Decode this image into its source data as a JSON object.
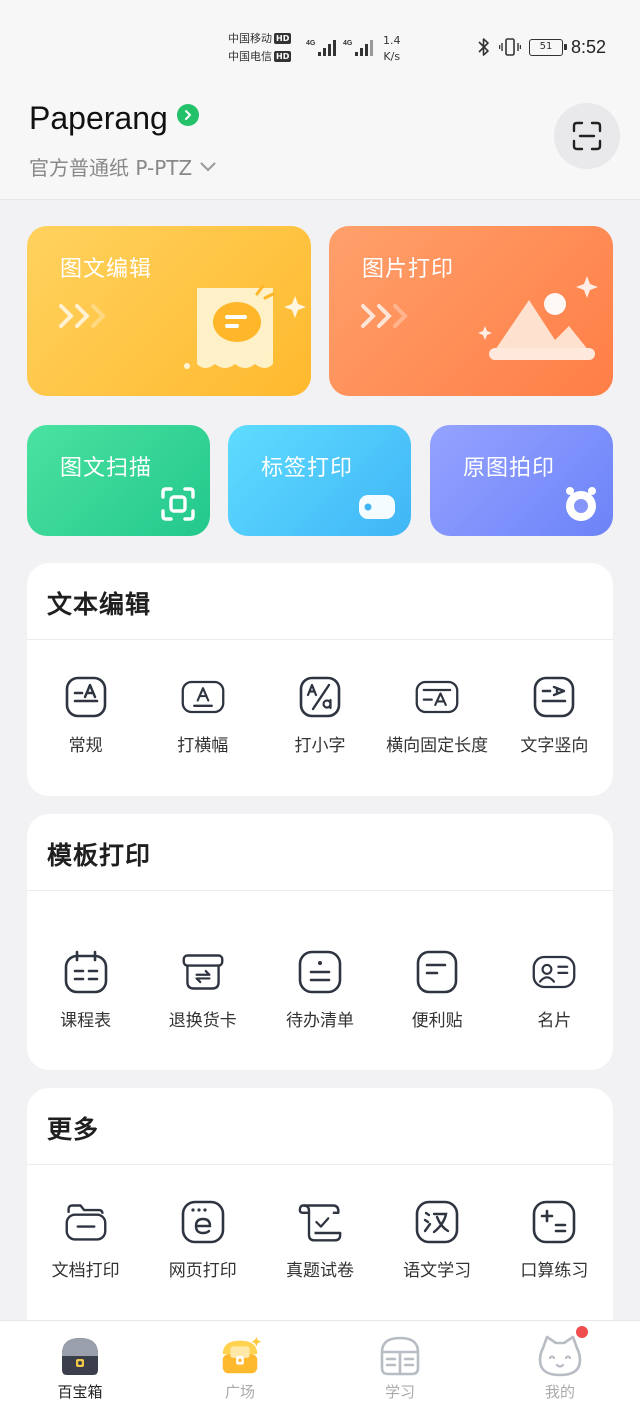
{
  "status_bar": {
    "carrier1": "中国移动",
    "carrier2": "中国电信",
    "hd": "HD",
    "net1": "4G",
    "net2": "4G",
    "speed_value": "1.4",
    "speed_unit": "K/s",
    "battery": "51",
    "time": "8:52"
  },
  "header": {
    "app_name": "Paperang",
    "paper_type": "官方普通纸 P-PTZ"
  },
  "feature_cards": {
    "big": [
      {
        "label": "图文编辑",
        "color": "#ffc542"
      },
      {
        "label": "图片打印",
        "color": "#ff8a55"
      }
    ],
    "mid": [
      {
        "label": "图文扫描",
        "color": "#33d596"
      },
      {
        "label": "标签打印",
        "color": "#4fc8fb"
      },
      {
        "label": "原图拍印",
        "color": "#7f93fb"
      }
    ]
  },
  "sections": {
    "text_edit": {
      "title": "文本编辑",
      "items": [
        {
          "label": "常规",
          "icon": "text-align-icon"
        },
        {
          "label": "打横幅",
          "icon": "banner-icon"
        },
        {
          "label": "打小字",
          "icon": "small-text-icon"
        },
        {
          "label": "横向固定长度",
          "icon": "fixed-length-icon"
        },
        {
          "label": "文字竖向",
          "icon": "vertical-text-icon"
        }
      ]
    },
    "template_print": {
      "title": "模板打印",
      "items": [
        {
          "label": "课程表",
          "icon": "calendar-icon"
        },
        {
          "label": "退换货卡",
          "icon": "return-box-icon"
        },
        {
          "label": "待办清单",
          "icon": "todo-list-icon"
        },
        {
          "label": "便利贴",
          "icon": "sticky-note-icon"
        },
        {
          "label": "名片",
          "icon": "business-card-icon"
        }
      ]
    },
    "more": {
      "title": "更多",
      "items": [
        {
          "label": "文档打印",
          "icon": "folder-icon"
        },
        {
          "label": "网页打印",
          "icon": "browser-icon"
        },
        {
          "label": "真题试卷",
          "icon": "exam-scroll-icon"
        },
        {
          "label": "语文学习",
          "icon": "chinese-char-icon"
        },
        {
          "label": "口算练习",
          "icon": "calculator-icon"
        }
      ]
    }
  },
  "bottom_nav": [
    {
      "label": "百宝箱",
      "active": true
    },
    {
      "label": "广场",
      "active": false
    },
    {
      "label": "学习",
      "active": false
    },
    {
      "label": "我的",
      "active": false
    }
  ],
  "colors": {
    "accent_green": "#22c16a",
    "notification_dot": "#f04e4e",
    "icon_stroke": "#2e3440"
  }
}
